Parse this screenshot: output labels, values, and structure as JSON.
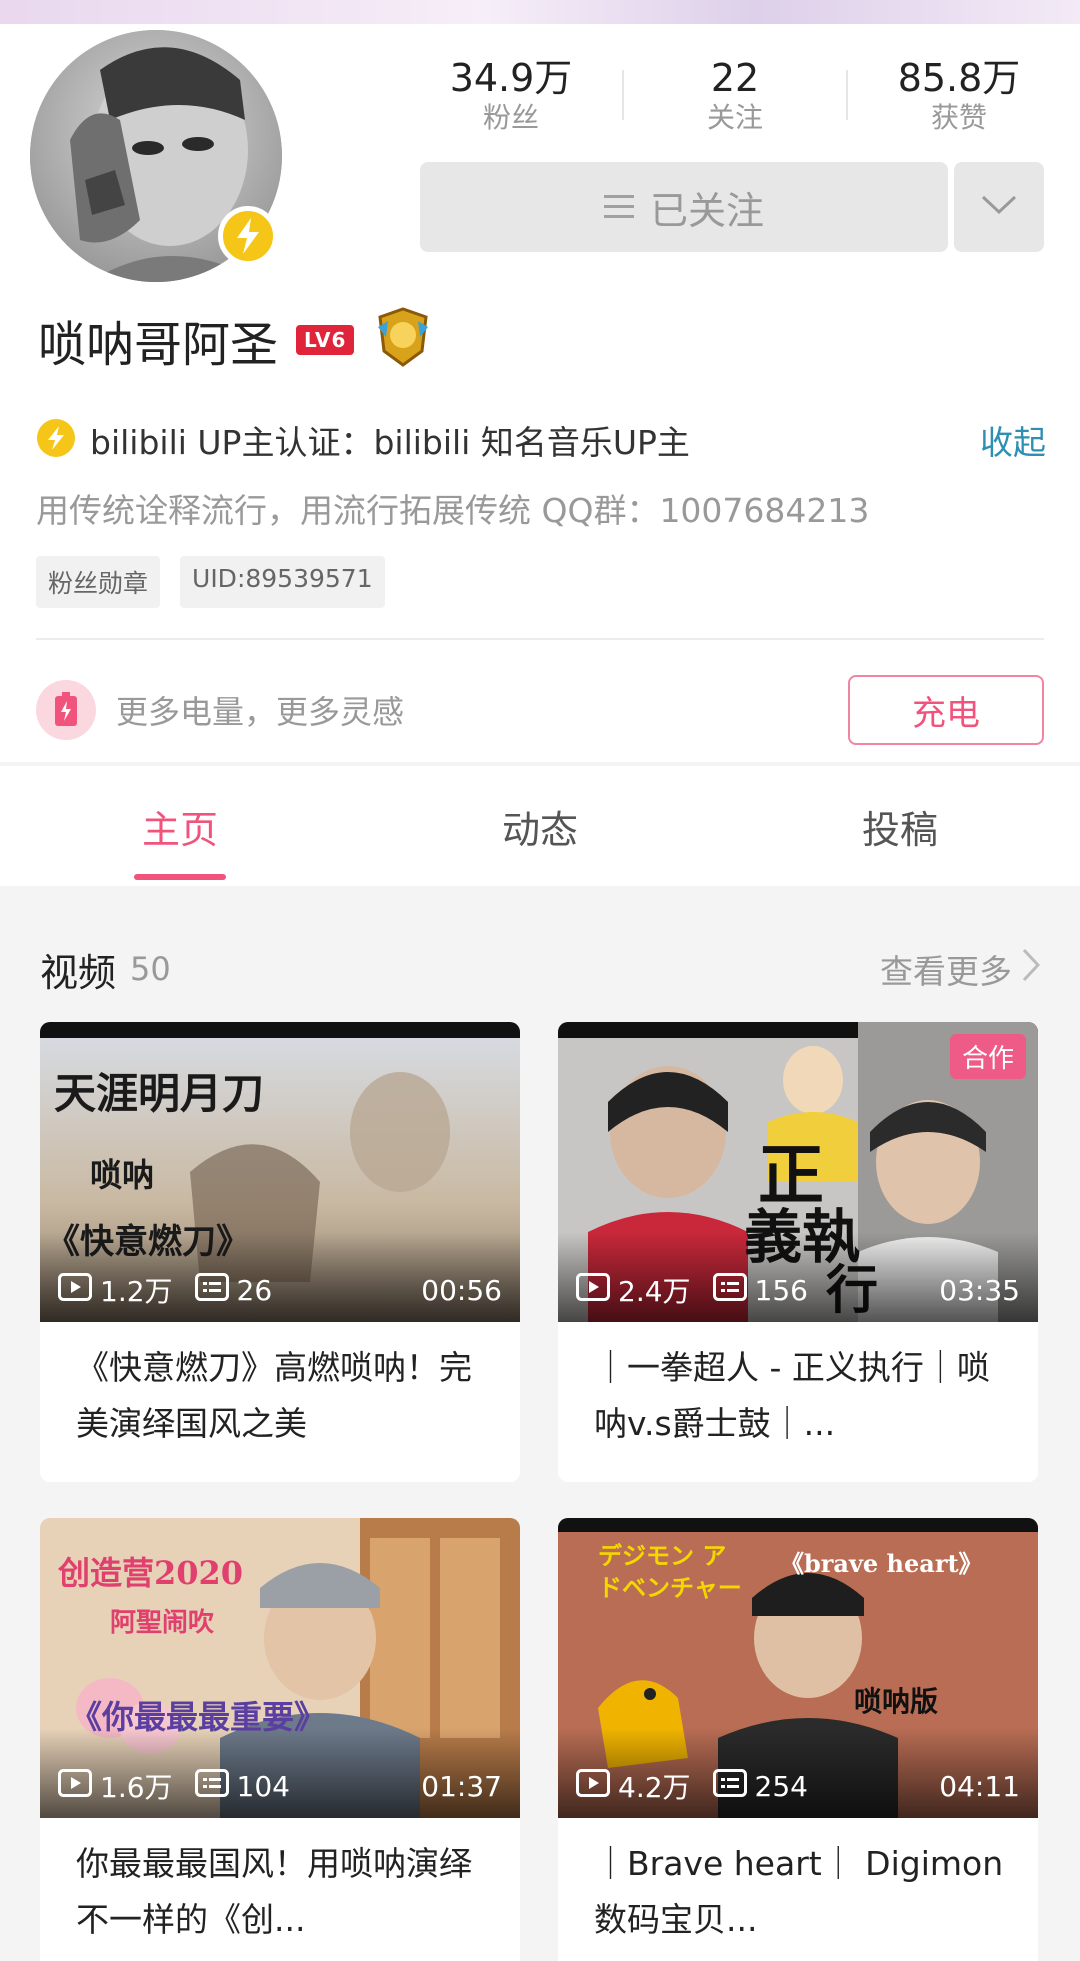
{
  "profile": {
    "stats": [
      {
        "value": "34.9万",
        "label": "粉丝"
      },
      {
        "value": "22",
        "label": "关注"
      },
      {
        "value": "85.8万",
        "label": "获赞"
      }
    ],
    "follow_label": "已关注",
    "name": "唢呐哥阿圣",
    "level": "LV6",
    "verify_text": "bilibili UP主认证：bilibili 知名音乐UP主",
    "collapse_label": "收起",
    "signature": "用传统诠释流行，用流行拓展传统 QQ群：1007684213",
    "tags": [
      "粉丝勋章",
      "UID:89539571"
    ],
    "charge_text": "更多电量，更多灵感",
    "charge_button": "充电"
  },
  "tabs": [
    {
      "label": "主页",
      "active": true
    },
    {
      "label": "动态",
      "active": false
    },
    {
      "label": "投稿",
      "active": false
    }
  ],
  "videos_section": {
    "title": "视频",
    "count": "50",
    "more_label": "查看更多"
  },
  "videos": [
    {
      "views": "1.2万",
      "danmaku": "26",
      "duration": "00:56",
      "title": "《快意燃刀》高燃唢呐！完美演绎国风之美",
      "thumb_text": [
        "天涯明月刀",
        "唢呐",
        "《快意燃刀》"
      ]
    },
    {
      "views": "2.4万",
      "danmaku": "156",
      "duration": "03:35",
      "title": "｜一拳超人 - 正义执行｜唢呐v.s爵士鼓｜...",
      "badge": "合作",
      "thumb_text": [
        "正",
        "義執",
        "行"
      ]
    },
    {
      "views": "1.6万",
      "danmaku": "104",
      "duration": "01:37",
      "title": "你最最最国风！用唢呐演绎不一样的《创...",
      "thumb_text": [
        "创造营2020",
        "阿聖闹吹",
        "《你最最最重要》"
      ]
    },
    {
      "views": "4.2万",
      "danmaku": "254",
      "duration": "04:11",
      "title": "｜Brave heart｜ Digimon 数码宝贝...",
      "thumb_text": [
        "デジモン アドベンチャー",
        "《brave heart》",
        "唢呐版"
      ]
    }
  ],
  "colors": {
    "accent": "#f0547d",
    "link": "#2e8fb3",
    "badge_gold": "#f5c518",
    "level_red": "#e0243a"
  }
}
